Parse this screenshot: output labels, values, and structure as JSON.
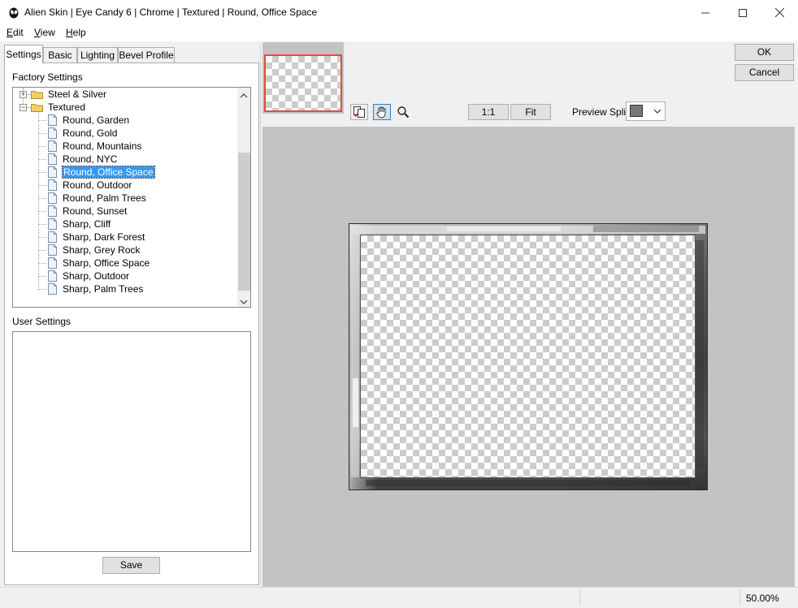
{
  "window": {
    "title": "Alien Skin | Eye Candy 6 | Chrome | Textured | Round, Office Space"
  },
  "menu": {
    "items": [
      {
        "first": "E",
        "rest": "dit"
      },
      {
        "first": "V",
        "rest": "iew"
      },
      {
        "first": "H",
        "rest": "elp"
      }
    ]
  },
  "tabs": [
    "Settings",
    "Basic",
    "Lighting",
    "Bevel Profile"
  ],
  "factory": {
    "label": "Factory Settings",
    "folders": [
      "Steel & Silver",
      "Textured"
    ],
    "items": [
      "Round, Garden",
      "Round, Gold",
      "Round, Mountains",
      "Round, NYC",
      "Round, Office Space",
      "Round, Outdoor",
      "Round, Palm Trees",
      "Round, Sunset",
      "Sharp, Cliff",
      "Sharp, Dark Forest",
      "Sharp, Grey Rock",
      "Sharp, Office Space",
      "Sharp, Outdoor",
      "Sharp, Palm Trees"
    ],
    "selected": "Round, Office Space"
  },
  "user": {
    "label": "User Settings",
    "save_label": "Save"
  },
  "toolbar": {
    "one_to_one": "1:1",
    "fit": "Fit",
    "preview_split_label": "Preview Split:"
  },
  "dialog": {
    "ok_label": "OK",
    "cancel_label": "Cancel"
  },
  "status": {
    "zoom": "50.00%"
  },
  "colors": {
    "selection": "#3399ff",
    "preview_bg": "#c3c3c3",
    "thumbnail_border": "#e14b3e"
  }
}
